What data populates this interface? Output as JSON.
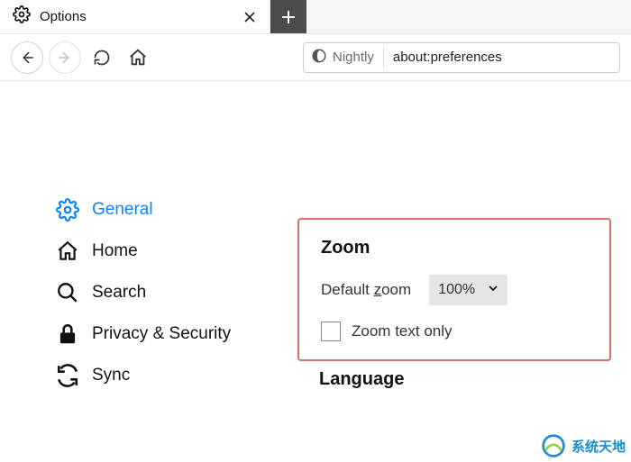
{
  "tab": {
    "title": "Options"
  },
  "urlbar": {
    "identity": "Nightly",
    "url": "about:preferences"
  },
  "sidebar": {
    "items": [
      {
        "label": "General"
      },
      {
        "label": "Home"
      },
      {
        "label": "Search"
      },
      {
        "label": "Privacy & Security"
      },
      {
        "label": "Sync"
      }
    ]
  },
  "zoom": {
    "heading": "Zoom",
    "default_label_pre": "Default ",
    "default_label_u": "z",
    "default_label_post": "oom",
    "value": "100%",
    "text_only_pre": "Zoom ",
    "text_only_u": "t",
    "text_only_post": "ext only"
  },
  "language": {
    "heading": "Language"
  },
  "watermark": {
    "text": "系统天地"
  }
}
